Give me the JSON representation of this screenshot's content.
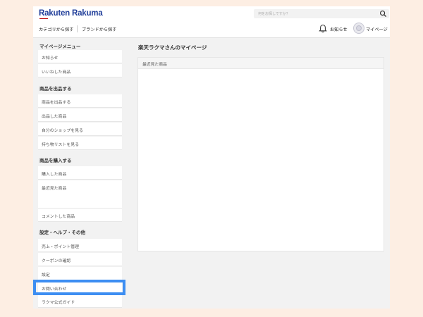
{
  "brand": {
    "logo_text": "Rakuten Rakuma"
  },
  "search": {
    "placeholder": "何をお探しですか？",
    "icon": "search-icon"
  },
  "header_nav": {
    "category": "カテゴリから探す",
    "brand": "ブランドから探す"
  },
  "header_actions": {
    "notifications": "お知らせ",
    "mypage": "マイページ"
  },
  "sidebar": {
    "sections": [
      {
        "title": "マイページメニュー",
        "items": [
          {
            "label": "お知らせ"
          },
          {
            "label": "いいねした商品"
          }
        ]
      },
      {
        "title": "商品を出品する",
        "items": [
          {
            "label": "商品を出品する"
          },
          {
            "label": "出品した商品"
          },
          {
            "label": "自分のショップを見る"
          },
          {
            "label": "持ち物リストを見る"
          }
        ]
      },
      {
        "title": "商品を購入する",
        "items": [
          {
            "label": "購入した商品"
          },
          {
            "label": "最近見た商品"
          },
          {
            "label": "コメントした商品"
          }
        ]
      },
      {
        "title": "設定・ヘルプ・その他",
        "items": [
          {
            "label": "売上・ポイント管理"
          },
          {
            "label": "クーポンの確認"
          },
          {
            "label": "設定"
          },
          {
            "label": "お問い合わせ"
          },
          {
            "label": "ラクマ公式ガイド"
          }
        ]
      }
    ]
  },
  "main": {
    "page_title": "楽天ラクマさんのマイページ",
    "panel_title": "最近見た商品"
  },
  "colors": {
    "brand_blue": "#1f3d99",
    "highlight": "#3d8ef2",
    "background": "#fdeee3"
  }
}
